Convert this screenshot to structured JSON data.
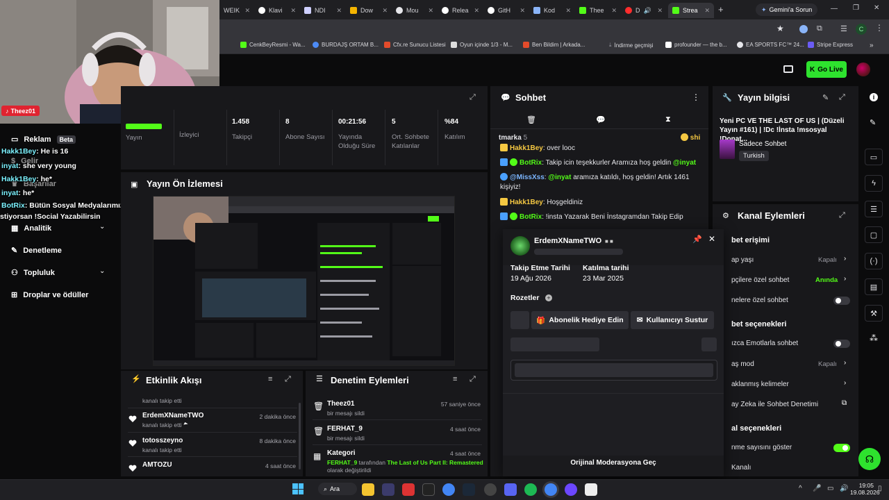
{
  "browser": {
    "tabs": [
      {
        "label": "WEIK",
        "active": false
      },
      {
        "label": "Klavi",
        "active": false
      },
      {
        "label": "NDI",
        "active": false
      },
      {
        "label": "Dow",
        "active": false
      },
      {
        "label": "Mou",
        "active": false
      },
      {
        "label": "Relea",
        "active": false
      },
      {
        "label": "GitH",
        "active": false
      },
      {
        "label": "Kod",
        "active": false
      },
      {
        "label": "Thee",
        "active": false
      },
      {
        "label": "D",
        "active": false
      },
      {
        "label": "Strea",
        "active": true
      }
    ],
    "gemini_label": "Gemini'a Sorun",
    "profile_initial": "C",
    "bookmarks": [
      "CenkBeyResmi - Wa...",
      "BURDAJŞ ORTAM B...",
      "Cfx.re Sunucu Listesi",
      "Oyun içinde 1/3 - M...",
      "Ben Bildim | Arkada...",
      "İndirme geçmişi",
      "profounder — the b...",
      "EA SPORTS FC™ 24...",
      "Stripe Express"
    ]
  },
  "header": {
    "go_live": "Go Live"
  },
  "overlay": {
    "streamer_tag": "Theez01",
    "chat": [
      {
        "name": "Hakk1Bey",
        "text": ": He is 16"
      },
      {
        "name": "inyat",
        "text": ": she very young"
      },
      {
        "name": "Hakk1Bey",
        "text": ": he*"
      },
      {
        "name": "inyat",
        "text": ": he*"
      },
      {
        "name": "BotRix",
        "text": ": Bütün Sosyal Medyalarımızdan bizi takip etmek"
      },
      {
        "name": "",
        "text": "stiyorsan !Social Yazabilirsin"
      }
    ]
  },
  "nav": {
    "reklam": "Reklam",
    "beta": "Beta",
    "gelir": "Gelir",
    "basarilar": "Başarılar",
    "analitik": "Analitik",
    "denetleme": "Denetleme",
    "topluluk": "Topluluk",
    "droplar": "Droplar ve ödüller"
  },
  "stats": {
    "yayin": "Yayın",
    "izleyici": "İzleyici",
    "items": [
      {
        "value": "1.458",
        "label": "Takipçi"
      },
      {
        "value": "8",
        "label": "Abone Sayısı"
      },
      {
        "value": "00:21:56",
        "label": "Yayında Olduğu Süre"
      },
      {
        "value": "5",
        "label": "Ort. Sohbete Katılanlar"
      },
      {
        "value": "%84",
        "label": "Katılım"
      }
    ]
  },
  "preview": {
    "title": "Yayın Ön İzlemesi"
  },
  "chat": {
    "title": "Sohbet",
    "top_user": "tmarka",
    "top_count": "5",
    "top_right": "shi",
    "messages": [
      {
        "user": "Hakk1Bey",
        "text": ": over looc"
      },
      {
        "user": "BotRix",
        "text": ": Takip icin teşekkurler Aramıza hoş geldin ",
        "mention": "@inyat"
      },
      {
        "user": "@MissXss",
        "text": ": ",
        "mention": "@inyat",
        "after": " aramıza katıldı, hoş geldin! Artık 1461 kişiyiz!"
      },
      {
        "user": "Hakk1Bey",
        "text": ": Hoşgeldiniz"
      },
      {
        "user": "BotRix",
        "text": ": !insta Yazarak Beni İnstagramdan Takip Edip"
      }
    ]
  },
  "popup": {
    "username": "ErdemXNameTWO",
    "follow_label": "Takip Etme Tarihi",
    "follow_value": "19 Ağu 2026",
    "join_label": "Katılma tarihi",
    "join_value": "23 Mar 2025",
    "badges_label": "Rozetler",
    "gift_btn": "Abonelik Hediye Edin",
    "mute_btn": "Kullanıcıyı Sustur",
    "mod_link": "Orijinal Moderasyona Geç"
  },
  "stream_info": {
    "title": "Yayın bilgisi",
    "stream_title": "Yeni PC VE THE LAST OF US | (Düzeli Yayın #161) | !Dc !İnsta !msosyal !Donat...",
    "category": "Sadece Sohbet",
    "language": "Turkish"
  },
  "channel_actions": {
    "title": "Kanal Eylemleri",
    "section1": "bet erişimi",
    "rows1": [
      {
        "label": "ap yaşı",
        "value": "Kapalı"
      },
      {
        "label": "pçilere özel sohbet",
        "value": "Anında"
      },
      {
        "label": "nelere özel sohbet",
        "value": ""
      }
    ],
    "section2": "bet seçenekleri",
    "rows2": [
      {
        "label": "ızca Emotlarla sohbet",
        "value": ""
      },
      {
        "label": "aş mod",
        "value": "Kapalı"
      },
      {
        "label": "aklanmış kelimeler",
        "value": ""
      },
      {
        "label": "ay Zeka ile Sohbet Denetimi",
        "value": ""
      }
    ],
    "section3": "al seçenekleri",
    "rows3": [
      {
        "label": "nme sayısını göster",
        "value": ""
      },
      {
        "label": "Kanalı",
        "value": ""
      }
    ]
  },
  "activity": {
    "title": "Etkinlik Akışı",
    "items": [
      {
        "name": "",
        "sub": "kanalı takip etti",
        "time": ""
      },
      {
        "name": "ErdemXNameTWO",
        "sub": "kanalı takip etti",
        "time": "2 dakika önce"
      },
      {
        "name": "totosszeyno",
        "sub": "kanalı takip etti",
        "time": "8 dakika önce"
      },
      {
        "name": "AMTOZU",
        "sub": "",
        "time": "4 saat önce"
      }
    ]
  },
  "moderation": {
    "title": "Denetim Eylemleri",
    "items": [
      {
        "name": "Theez01",
        "sub": "bir mesajı sildi",
        "time": "57 saniye önce"
      },
      {
        "name": "FERHAT_9",
        "sub": "bir mesajı sildi",
        "time": "4 saat önce"
      },
      {
        "name": "Kategori",
        "sub_user": "FERHAT_9",
        "sub_mid": " tarafından ",
        "sub_game": "The Last of Us Part II: Remastered",
        "sub_end": "olarak değiştirildi",
        "time": "4 saat önce"
      }
    ]
  },
  "taskbar": {
    "search": "Ara",
    "time": "19:05",
    "date": "19.08.2026"
  },
  "colors": {
    "accent": "#53fc18",
    "panel": "#18181b",
    "bg": "#0b0b0c"
  }
}
